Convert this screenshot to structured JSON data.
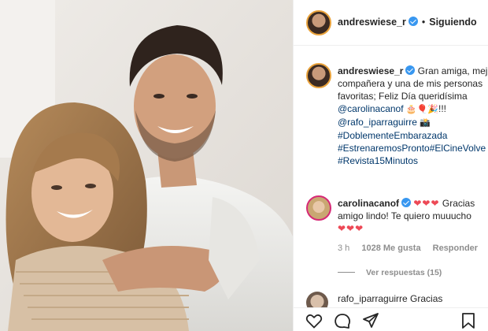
{
  "post": {
    "username": "andreswiese_r",
    "separator": "•",
    "follow_status": "Siguiendo"
  },
  "caption": {
    "username": "andreswiese_r",
    "line1": "Gran amiga, mej",
    "line2": "compañera y una de mis personas",
    "line3": "favoritas; Feliz Día queridísima",
    "mention1": "@carolinacanof",
    "line4_suffix": "!!!",
    "mention2": "@rafo_iparraguirre",
    "tag1": "#DoblementeEmbarazada",
    "tag2a": "#EstrenaremosPronto",
    "tag2b": "#ElCineVolve",
    "tag3": "#Revista15Minutos"
  },
  "comment": {
    "username": "carolinacanof",
    "text_a": "Gracias",
    "text_b": "amigo lindo! Te quiero muuucho",
    "time": "3 h",
    "likes": "1028 Me gusta",
    "reply": "Responder",
    "view_replies": "Ver respuestas (15)"
  },
  "next_comment": {
    "text": "rafo_iparraguirre  Gracias"
  },
  "icons": {
    "like": "heart-outline-icon",
    "comment": "comment-bubble-icon",
    "share": "paper-plane-icon",
    "save": "bookmark-icon"
  },
  "colors": {
    "verified": "#3897f0",
    "link": "#00376b",
    "heart": "#ed4956",
    "muted": "#8e8e8e"
  }
}
